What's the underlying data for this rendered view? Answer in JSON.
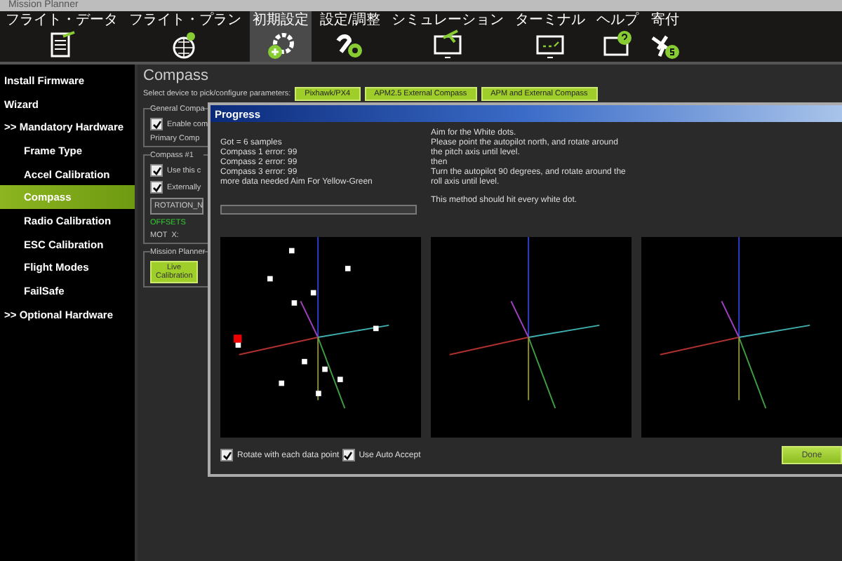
{
  "window": {
    "title": "Mission Planner"
  },
  "menu": [
    {
      "label": "フライト・データ",
      "kind": "doc",
      "selected": false
    },
    {
      "label": "フライト・プラン",
      "kind": "globe",
      "selected": false
    },
    {
      "label": "初期設定",
      "kind": "gear",
      "selected": true
    },
    {
      "label": "設定/調整",
      "kind": "wrench",
      "selected": false
    },
    {
      "label": "シミュレーション",
      "kind": "monitor-plane",
      "selected": false
    },
    {
      "label": "ターミナル",
      "kind": "terminal",
      "selected": false
    },
    {
      "label": "ヘルプ",
      "kind": "help",
      "selected": false
    },
    {
      "label": "寄付",
      "kind": "donate",
      "selected": false
    }
  ],
  "sidebar": {
    "items": [
      {
        "label": "Install Firmware",
        "selected": false
      },
      {
        "label": "Wizard",
        "selected": false
      },
      {
        "label": ">> Mandatory Hardware",
        "selected": false,
        "children": [
          {
            "label": "Frame Type",
            "selected": false
          },
          {
            "label": "Accel Calibration",
            "selected": false
          },
          {
            "label": "Compass",
            "selected": true
          },
          {
            "label": "Radio Calibration",
            "selected": false
          },
          {
            "label": "ESC Calibration",
            "selected": false
          },
          {
            "label": "Flight Modes",
            "selected": false
          },
          {
            "label": "FailSafe",
            "selected": false
          }
        ]
      },
      {
        "label": ">> Optional Hardware",
        "selected": false
      }
    ]
  },
  "compass_page": {
    "title": "Compass",
    "prompt": "Select device to pick/configure parameters:",
    "device_buttons": [
      "Pixhawk/PX4",
      "APM2.5 External Compass",
      "APM and External Compass"
    ],
    "general_group": {
      "title": "General Compa",
      "checkbox": {
        "label": "Enable com",
        "checked": true
      },
      "primary": "Primary Comp"
    },
    "compass1_group": {
      "title": "Compass #1",
      "checkboxes": [
        {
          "label": "Use this c",
          "checked": true
        },
        {
          "label": "Externally",
          "checked": true
        }
      ],
      "rotation": "ROTATION_N",
      "offsets": "OFFSETS",
      "mot": "MOT",
      "x": "X:"
    },
    "planner_group": {
      "title": "Mission Planner",
      "button": "Live Calibration"
    }
  },
  "progress_dialog": {
    "title": "Progress",
    "status_lines": [
      "Got = 6 samples",
      "Compass 1 error: 99",
      "Compass 2 error: 99",
      "Compass 3 error: 99",
      "more data needed Aim For Yellow-Green"
    ],
    "instructions": [
      "Aim for the White dots.",
      "Please point the autopilot north, and rotate around",
      "the pitch axis until level.",
      "then",
      "Turn the autopilot 90 degrees, and rotate around the",
      "roll axis until level."
    ],
    "progress": {
      "level": 0
    },
    "hint": "This method should hit every white dot.",
    "checkboxes": [
      {
        "label": "Rotate with each data point",
        "checked": true
      },
      {
        "label": "Use Auto Accept",
        "checked": true
      }
    ],
    "button": "Done"
  }
}
